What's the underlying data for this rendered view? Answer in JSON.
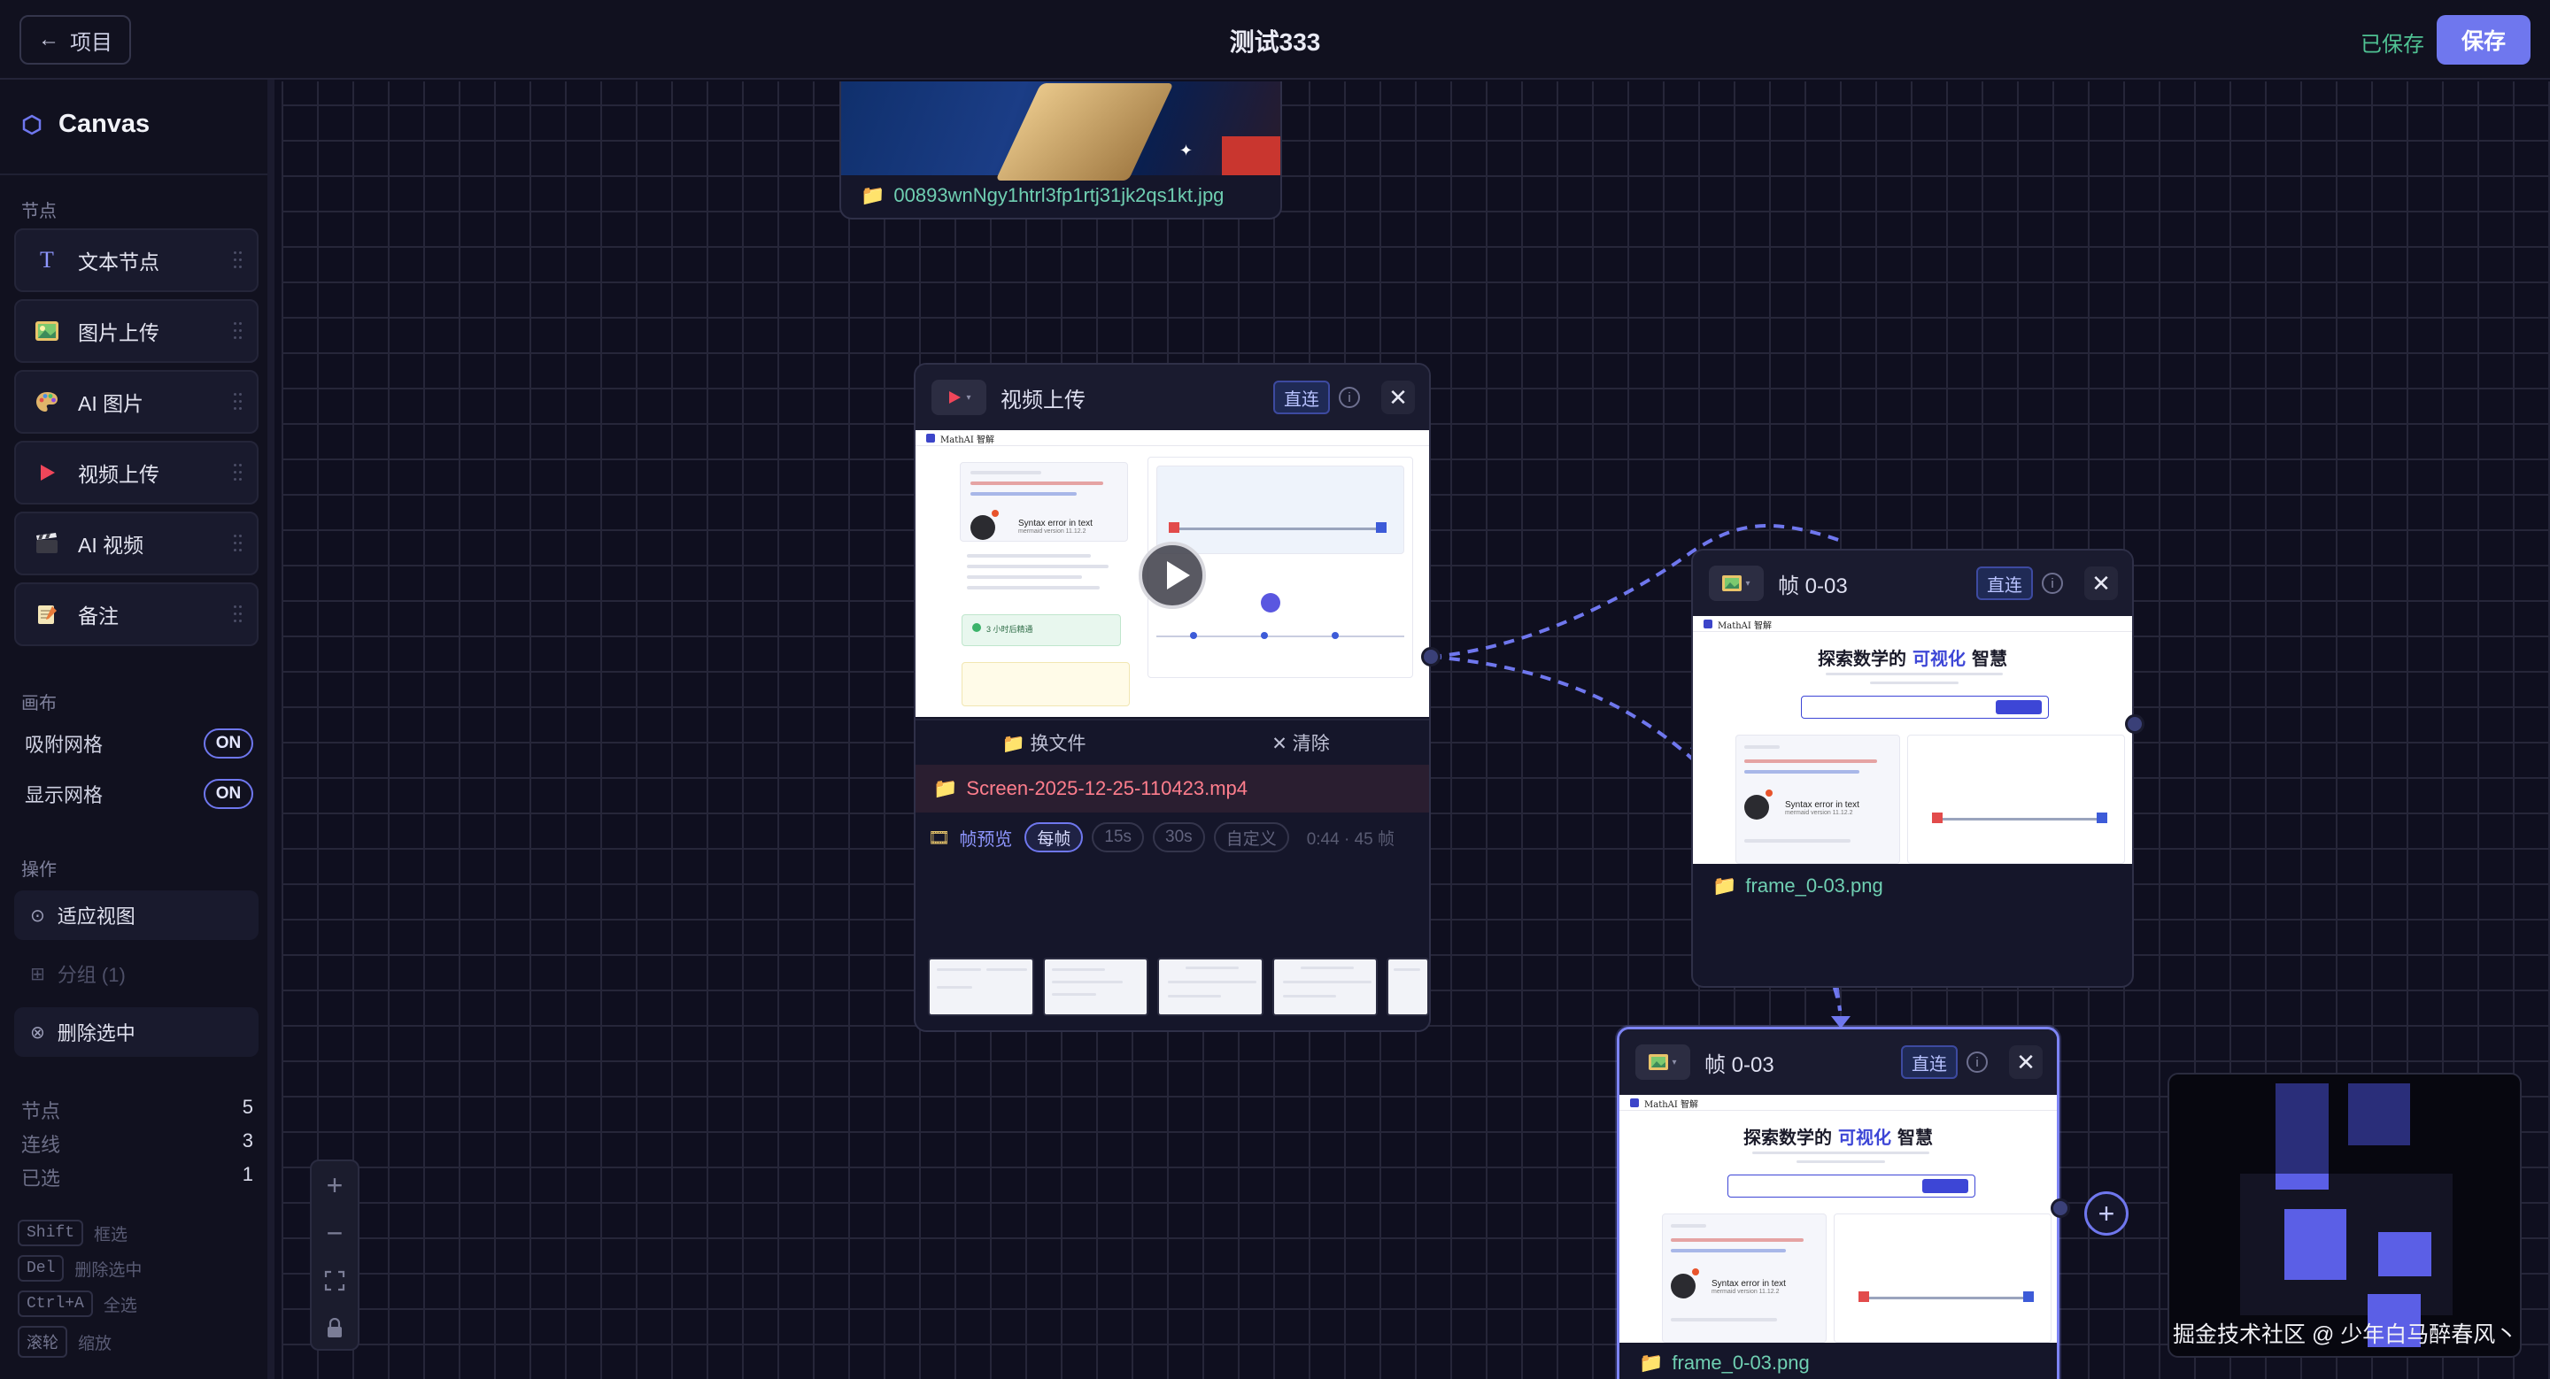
{
  "header": {
    "back_label": "项目",
    "title": "测试333",
    "saved_status": "已保存",
    "save_label": "保存"
  },
  "sidebar": {
    "brand": "Canvas",
    "sections": {
      "nodes": "节点",
      "canvas": "画布",
      "actions": "操作"
    },
    "node_items": [
      {
        "label": "文本节点",
        "icon": "text-icon"
      },
      {
        "label": "图片上传",
        "icon": "image-icon"
      },
      {
        "label": "AI 图片",
        "icon": "palette-icon"
      },
      {
        "label": "视频上传",
        "icon": "play-icon"
      },
      {
        "label": "AI 视频",
        "icon": "clapper-icon"
      },
      {
        "label": "备注",
        "icon": "memo-icon"
      }
    ],
    "toggles": [
      {
        "label": "吸附网格",
        "state": "ON"
      },
      {
        "label": "显示网格",
        "state": "ON"
      }
    ],
    "actions": [
      {
        "label": "适应视图",
        "icon": "target-icon",
        "enabled": true
      },
      {
        "label": "分组 (1)",
        "icon": "group-icon",
        "enabled": false
      },
      {
        "label": "删除选中",
        "icon": "delete-icon",
        "enabled": true
      }
    ],
    "stats": [
      {
        "label": "节点",
        "value": "5"
      },
      {
        "label": "连线",
        "value": "3"
      },
      {
        "label": "已选",
        "value": "1"
      }
    ],
    "shortcuts": [
      {
        "key": "Shift",
        "desc": "框选"
      },
      {
        "key": "Del",
        "desc": "删除选中"
      },
      {
        "key": "Ctrl+A",
        "desc": "全选"
      },
      {
        "key": "滚轮",
        "desc": "缩放"
      }
    ]
  },
  "canvas": {
    "image_node": {
      "filename": "00893wnNgy1htrl3fp1rtj31jk2qs1kt.jpg"
    },
    "video_node": {
      "title": "视频上传",
      "direct_label": "直连",
      "info": "i",
      "close": "✕",
      "replace_label": "换文件",
      "clear_label": "清除",
      "filename": "Screen-2025-12-25-110423.mp4",
      "frame_preview_label": "帧预览",
      "chips": [
        "每帧",
        "15s",
        "30s",
        "自定义"
      ],
      "active_chip": "每帧",
      "frame_meta": "0:44 · 45 帧",
      "video_mock": {
        "brand": "MathAI 智解",
        "error_title": "Syntax error in text",
        "error_sub": "mermaid version 11.12.2",
        "badge": "3 小时后精通"
      }
    },
    "frame_node_a": {
      "title": "帧 0-03",
      "direct_label": "直连",
      "info": "i",
      "close": "✕",
      "filename": "frame_0-03.png",
      "mock": {
        "brand": "MathAI 智解",
        "headline_a": "探索数学的",
        "headline_b": "可视化",
        "headline_c": "智慧",
        "error_title": "Syntax error in text",
        "error_sub": "mermaid version 11.12.2"
      }
    },
    "frame_node_b": {
      "title": "帧 0-03",
      "direct_label": "直连",
      "info": "i",
      "close": "✕",
      "filename": "frame_0-03.png",
      "mock": {
        "brand": "MathAI 智解",
        "headline_a": "探索数学的",
        "headline_b": "可视化",
        "headline_c": "智慧",
        "error_title": "Syntax error in text",
        "error_sub": "mermaid version 11.12.2"
      }
    },
    "add_button": "+",
    "edge_color": "#6f77ee"
  },
  "zoom": {
    "in": "+",
    "out": "−"
  },
  "watermark": "掘金技术社区 @ 少年白马醉春风丶",
  "colors": {
    "accent": "#6f77ee",
    "saved_green": "#4fc293",
    "filename_teal": "#6fcfb2",
    "video_red": "#ff7e8d",
    "background": "#0f0f1f"
  }
}
